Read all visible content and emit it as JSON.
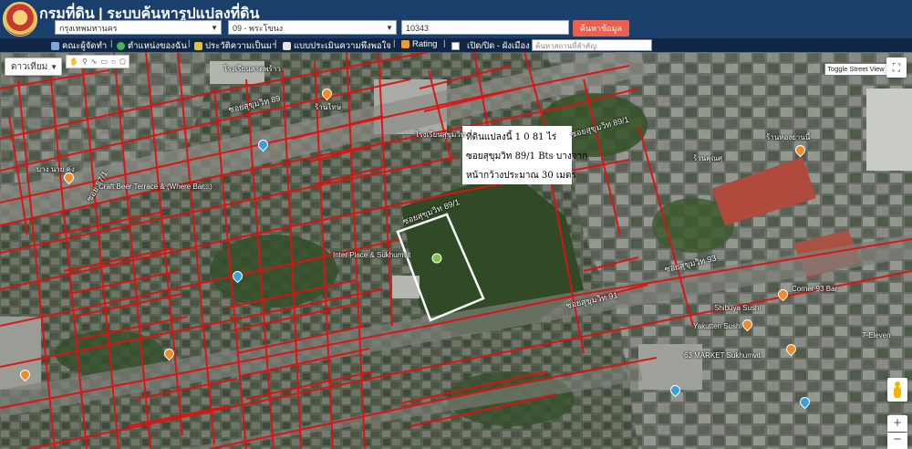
{
  "header": {
    "title": "กรมที่ดิน | ระบบค้นหารูปแปลงที่ดิน",
    "province": "กรุงเทพมหานคร",
    "district": "09 - พระโขนง",
    "parcel_number": "10343",
    "search_button": "ค้นหาข้อมูล"
  },
  "toolbar": {
    "items": [
      {
        "label": "คณะผู้จัดทำ",
        "icon": "building-icon",
        "color": "#7fa7d9"
      },
      {
        "label": "ตำแหน่งของฉัน",
        "icon": "globe-icon",
        "color": "#4caf50"
      },
      {
        "label": "ประวัติความเป็นมา",
        "icon": "plant-icon",
        "color": "#e0c040"
      },
      {
        "label": "แบบประเมินความพึงพอใจ",
        "icon": "document-icon",
        "color": "#e6e6e6"
      },
      {
        "label": "Rating",
        "icon": "chart-icon",
        "color": "#e89b3a"
      },
      {
        "label": "เปิด/ปิด - ผังเมือง",
        "icon": "checkbox-icon",
        "color": "#ffffff"
      }
    ],
    "place_search_placeholder": "ค้นหาสถานที่สำคัญ"
  },
  "map": {
    "map_type": "ดาวเทียม",
    "street_view_label": "Toggle Street View",
    "info_lines": [
      "ที่ดินแปลงนี้ 1 0 81 ไร่",
      "ซอยสุขุมวิท 89/1 Bts บางจาก",
      "หน้ากว้างประมาณ 30 เมตร"
    ],
    "road_labels": [
      "ซอยสุขุมวิท 89/1",
      "ซอยสุขุมวิท 89",
      "ซอยสุขุมวิท 91",
      "ซอยสุขุมวิท 93",
      "ซอยสุขุมวิท 89/1",
      "ซอย 87/1"
    ],
    "place_labels": [
      "Craft Beer Terrace & (Where Bar...)",
      "Inter Place & Sukhumvit",
      "โรงเรียนสุขุมวิท",
      "Corner 93 Bar",
      "Shibuya Sushi",
      "Yakutten Sushi",
      "63 MARKET Sukhumvit",
      "7-Eleven",
      "ร้านทองย่านนี้",
      "ร้านคุณศุ",
      "ร้านโทษ",
      "โรงเรียนลาดพร้าว",
      "บาง นาย คุ่ง"
    ]
  },
  "colors": {
    "header_bg": "#1b3f6b",
    "toolbar_bg": "#0f2745",
    "search_button_bg": "#e8604f",
    "parcel_lines": "#e01010",
    "selection_outline": "#ffffff"
  }
}
